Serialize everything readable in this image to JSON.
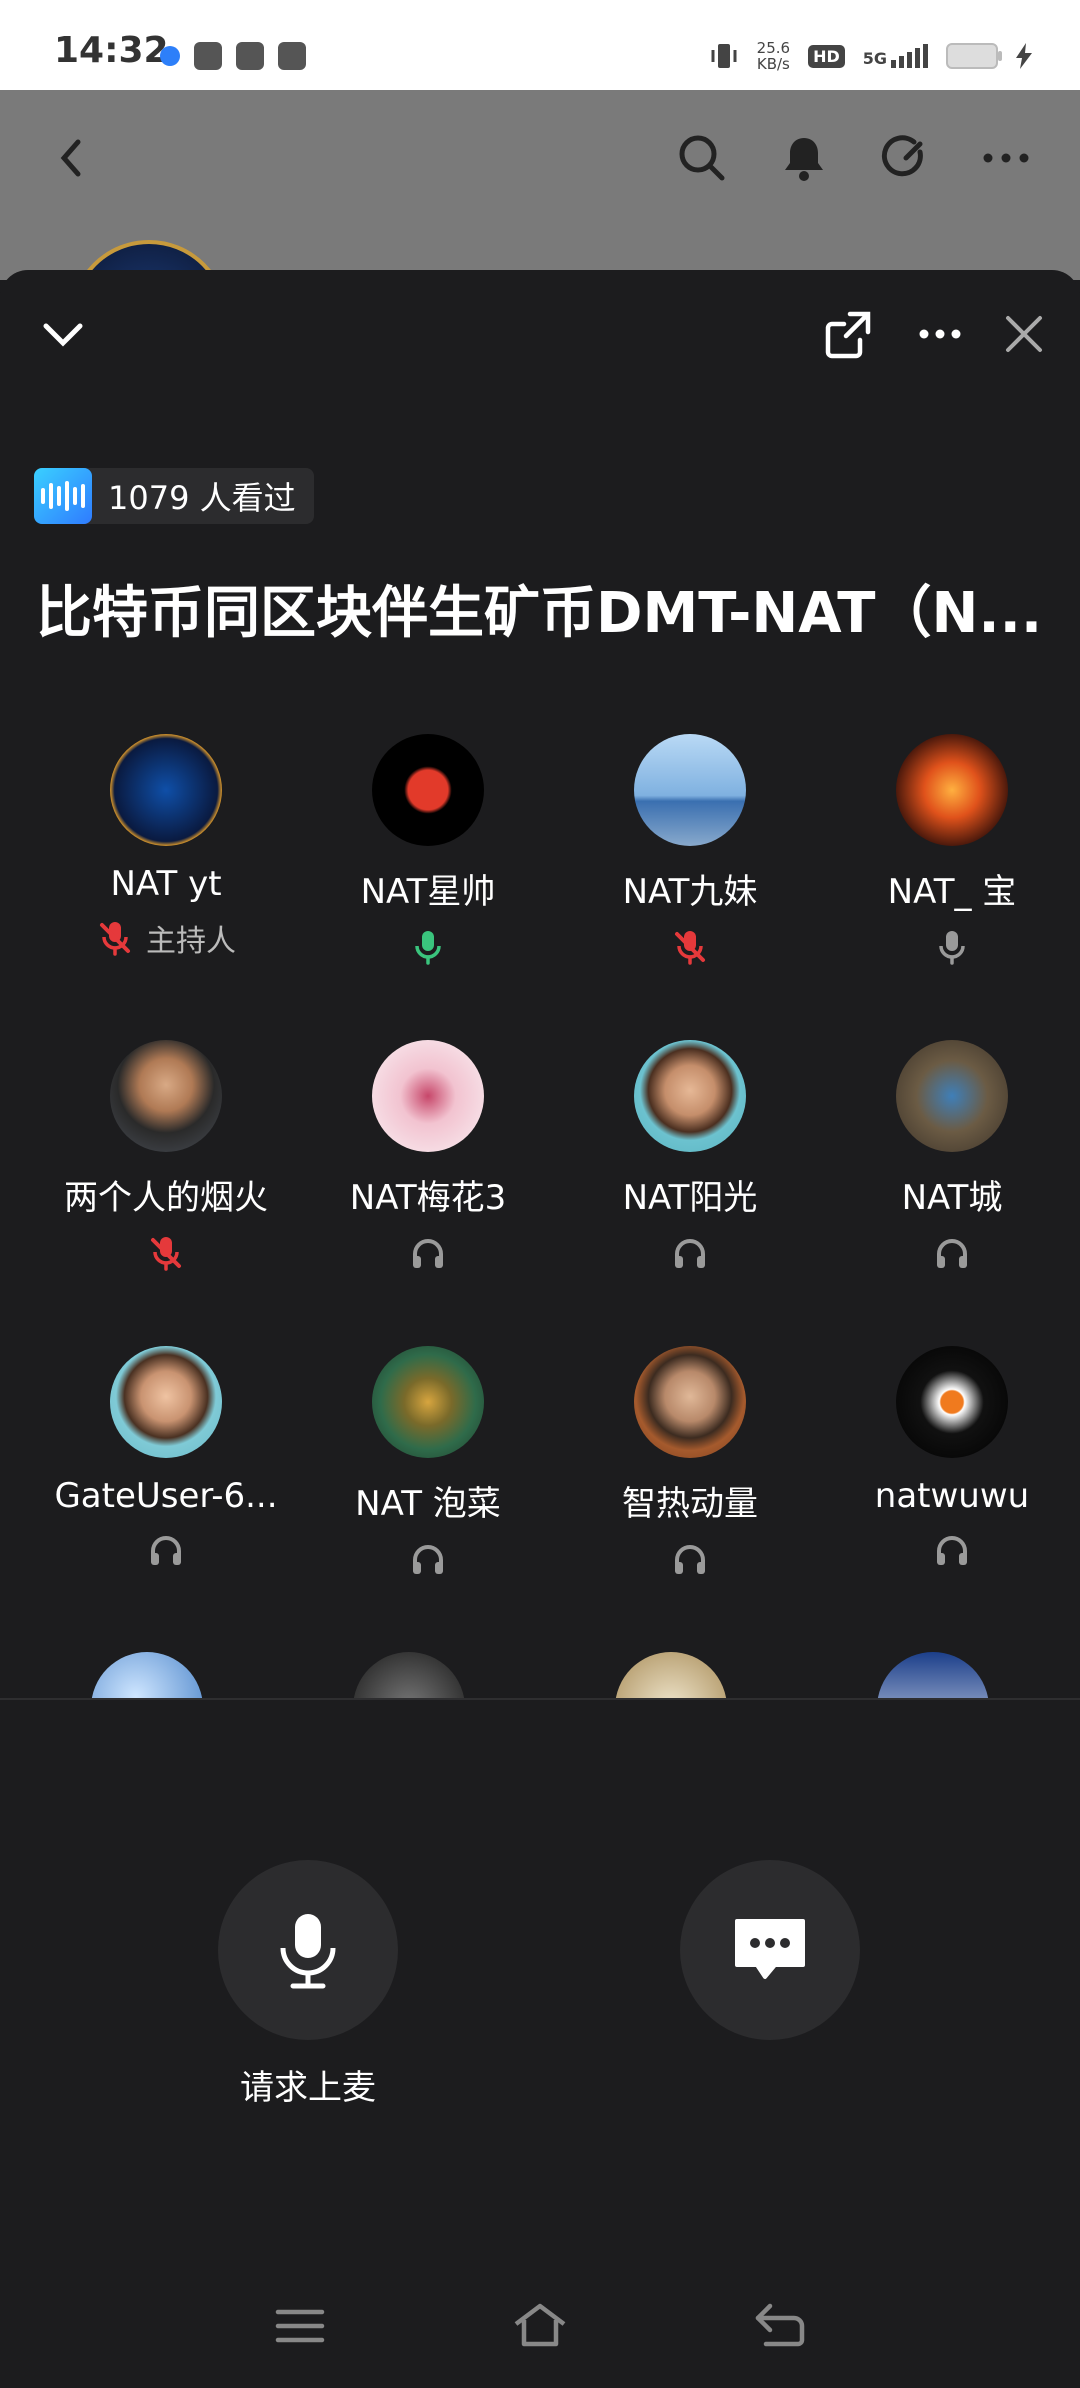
{
  "status_bar": {
    "time": "14:32",
    "speed_value": "25.6",
    "speed_unit": "KB/s",
    "hd": "HD",
    "network": "5G"
  },
  "sheet": {
    "view_count": "1079 人看过",
    "title": "比特币同区块伴生矿币DMT-NAT（N..."
  },
  "participants": [
    {
      "name": "NAT yt",
      "status": "muted-mic",
      "role": "主持人",
      "avatar": "blue-network-logo"
    },
    {
      "name": "NAT星帅",
      "status": "mic-on",
      "avatar": "red-seal-network"
    },
    {
      "name": "NAT九妹",
      "status": "muted-mic",
      "avatar": "sky-figure-photo"
    },
    {
      "name": "NAT_ 宝",
      "status": "mic-idle",
      "avatar": "orange-glow-network"
    },
    {
      "name": "两个人的烟火",
      "status": "muted-mic",
      "avatar": "man-portrait"
    },
    {
      "name": "NAT梅花3",
      "status": "listener",
      "avatar": "pink-network"
    },
    {
      "name": "NAT阳光",
      "status": "listener",
      "avatar": "man-portrait-2"
    },
    {
      "name": "NAT城",
      "status": "listener",
      "avatar": "gear-bitcoin"
    },
    {
      "name": "GateUser-6...",
      "status": "listener",
      "avatar": "man-portrait-3"
    },
    {
      "name": "NAT 泡菜",
      "status": "listener",
      "avatar": "green-gold-network"
    },
    {
      "name": "智热动量",
      "status": "listener",
      "avatar": "man-glasses"
    },
    {
      "name": "natwuwu",
      "status": "listener",
      "avatar": "white-network-orange"
    }
  ],
  "actions": {
    "request_mic_label": "请求上麦"
  },
  "colors": {
    "muted": "#e5393b",
    "mic_on": "#3ac47d",
    "idle": "#9a9a9a"
  }
}
